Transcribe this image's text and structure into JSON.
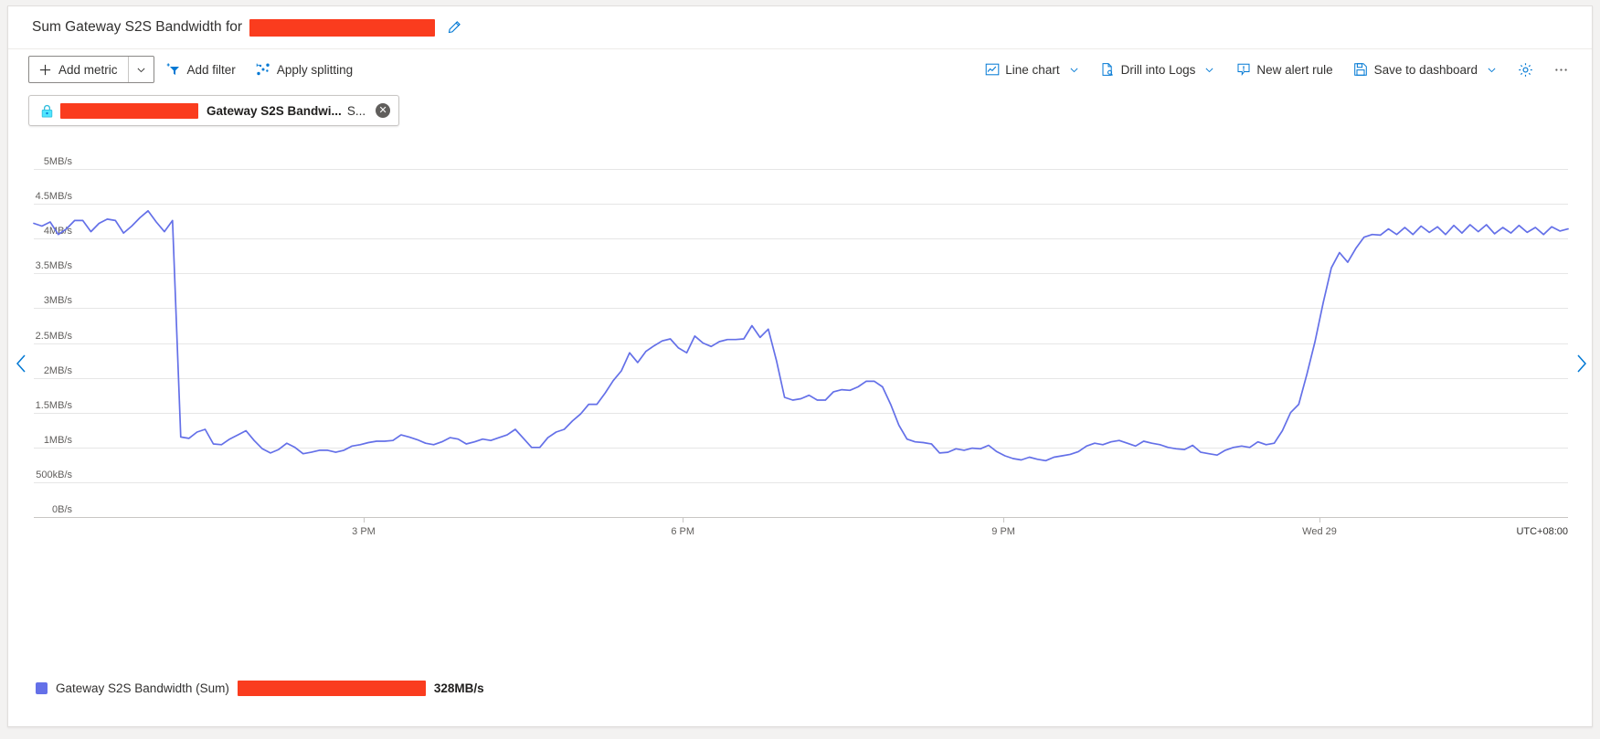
{
  "header": {
    "title_prefix": "Sum Gateway S2S Bandwidth for",
    "resource_redacted": true,
    "edit_icon": "pencil-icon"
  },
  "toolbar": {
    "add_metric_label": "Add metric",
    "add_metric_icon": "plus-icon",
    "add_metric_caret_icon": "chevron-down-icon",
    "add_filter_label": "Add filter",
    "add_filter_icon": "filter-add-icon",
    "apply_splitting_label": "Apply splitting",
    "apply_splitting_icon": "splitting-icon",
    "chart_type_label": "Line chart",
    "chart_type_icon": "line-chart-icon",
    "drill_into_logs_label": "Drill into Logs",
    "drill_into_logs_icon": "logs-icon",
    "new_alert_rule_label": "New alert rule",
    "new_alert_rule_icon": "alert-bell-icon",
    "save_to_dashboard_label": "Save to dashboard",
    "save_to_dashboard_icon": "save-floppy-icon",
    "settings_icon": "gear-icon",
    "more_icon": "ellipsis-icon"
  },
  "metric_chip": {
    "scope_icon": "vpn-gateway-lock-icon",
    "scope_redacted": true,
    "metric_label": "Gateway S2S Bandwi...",
    "aggregation_label": "S...",
    "close_icon": "close-circle-icon"
  },
  "navigation": {
    "prev_icon": "chevron-left-icon",
    "next_icon": "chevron-right-icon"
  },
  "legend": {
    "swatch_color": "#6470e8",
    "series_label": "Gateway S2S Bandwidth (Sum)",
    "resource_redacted": true,
    "value": "328MB/s"
  },
  "colors": {
    "accent": "#0078d4",
    "line": "#6470e8",
    "redaction": "#fa3c1e",
    "grid": "#e6e6e6",
    "axis_text": "#605e5c"
  },
  "chart_data": {
    "type": "line",
    "title": "Sum Gateway S2S Bandwidth for",
    "xlabel": "",
    "ylabel": "",
    "timezone": "UTC+08:00",
    "grid": true,
    "legend_position": "bottom-left",
    "ytick_labels": [
      "5MB/s",
      "4.5MB/s",
      "4MB/s",
      "3.5MB/s",
      "3MB/s",
      "2.5MB/s",
      "2MB/s",
      "1.5MB/s",
      "1MB/s",
      "500kB/s",
      "0B/s"
    ],
    "ytick_values": [
      5000000,
      4500000,
      4000000,
      3500000,
      3000000,
      2500000,
      2000000,
      1500000,
      1000000,
      500000,
      0
    ],
    "ylim": [
      0,
      5250000
    ],
    "yunit": "B/s",
    "xtick_labels": [
      "3 PM",
      "6 PM",
      "9 PM",
      "Wed 29"
    ],
    "xtick_positions": [
      0.215,
      0.423,
      0.632,
      0.838
    ],
    "series": [
      {
        "name": "Gateway S2S Bandwidth (Sum)",
        "color": "#6470e8",
        "values": [
          4.22,
          4.18,
          4.24,
          4.06,
          4.14,
          4.26,
          4.26,
          4.1,
          4.22,
          4.28,
          4.26,
          4.08,
          4.18,
          4.3,
          4.4,
          4.24,
          4.1,
          4.26,
          1.15,
          1.13,
          1.22,
          1.26,
          1.05,
          1.04,
          1.12,
          1.18,
          1.24,
          1.1,
          0.98,
          0.92,
          0.97,
          1.06,
          1.0,
          0.91,
          0.93,
          0.96,
          0.96,
          0.93,
          0.96,
          1.02,
          1.04,
          1.07,
          1.09,
          1.09,
          1.1,
          1.18,
          1.15,
          1.11,
          1.06,
          1.04,
          1.08,
          1.14,
          1.12,
          1.05,
          1.08,
          1.12,
          1.1,
          1.14,
          1.18,
          1.26,
          1.13,
          1.0,
          1.0,
          1.14,
          1.22,
          1.26,
          1.38,
          1.48,
          1.62,
          1.62,
          1.78,
          1.96,
          2.1,
          2.36,
          2.22,
          2.38,
          2.46,
          2.53,
          2.56,
          2.43,
          2.36,
          2.6,
          2.5,
          2.45,
          2.52,
          2.55,
          2.55,
          2.56,
          2.75,
          2.58,
          2.7,
          2.25,
          1.72,
          1.68,
          1.7,
          1.75,
          1.68,
          1.68,
          1.8,
          1.83,
          1.82,
          1.87,
          1.95,
          1.95,
          1.87,
          1.62,
          1.32,
          1.12,
          1.08,
          1.07,
          1.05,
          0.92,
          0.93,
          0.98,
          0.96,
          0.99,
          0.98,
          1.03,
          0.94,
          0.88,
          0.84,
          0.82,
          0.86,
          0.83,
          0.81,
          0.86,
          0.88,
          0.9,
          0.94,
          1.02,
          1.06,
          1.04,
          1.08,
          1.1,
          1.06,
          1.02,
          1.09,
          1.06,
          1.04,
          1.0,
          0.98,
          0.97,
          1.03,
          0.93,
          0.91,
          0.89,
          0.96,
          1.0,
          1.02,
          1.0,
          1.08,
          1.04,
          1.06,
          1.24,
          1.5,
          1.62,
          2.05,
          2.52,
          3.08,
          3.58,
          3.8,
          3.66,
          3.86,
          4.02,
          4.06,
          4.05,
          4.14,
          4.06,
          4.16,
          4.06,
          4.18,
          4.09,
          4.17,
          4.06,
          4.19,
          4.08,
          4.2,
          4.1,
          4.2,
          4.07,
          4.16,
          4.08,
          4.19,
          4.09,
          4.16,
          4.06,
          4.17,
          4.11,
          4.14
        ],
        "unit": "MB/s",
        "max_label": "328MB/s"
      }
    ]
  }
}
